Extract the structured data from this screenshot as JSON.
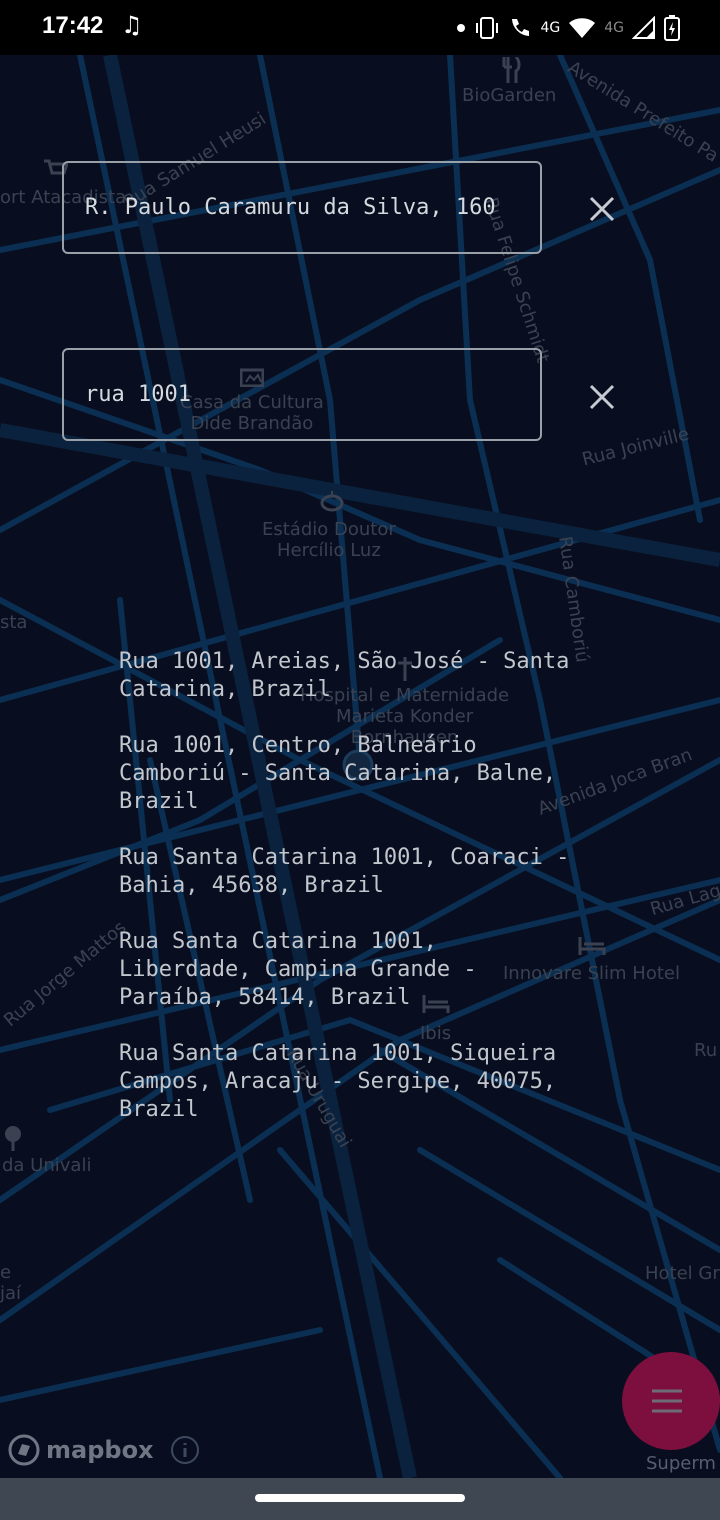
{
  "status_bar": {
    "time": "17:42",
    "network_labels": [
      "4G",
      "4G"
    ]
  },
  "map": {
    "labels": [
      {
        "id": "biogarden",
        "text": "BioGarden"
      },
      {
        "id": "atacadista",
        "text": "ort Atacadista"
      },
      {
        "id": "rua-samuel-heusi",
        "text": "Rua Samuel Heusi"
      },
      {
        "id": "av-prefeito",
        "text": "Avenida Prefeito Pa"
      },
      {
        "id": "rua-felipe-schmidt",
        "text": "Rua Felipe Schmidt"
      },
      {
        "id": "casa-cultura",
        "text": "Casa da Cultura\nDide Brandão"
      },
      {
        "id": "rua-joinville",
        "text": "Rua Joinville"
      },
      {
        "id": "estadio",
        "text": "Estádio Doutor\nHercílio Luz"
      },
      {
        "id": "rua-camboriu",
        "text": "Rua Camboriú"
      },
      {
        "id": "sta",
        "text": "sta"
      },
      {
        "id": "hospital",
        "text": "Hospital e Maternidade\nMarieta Konder\nBornhausen"
      },
      {
        "id": "av-joca",
        "text": "Avenida Joca Bran"
      },
      {
        "id": "rua-la",
        "text": "Rua Lag"
      },
      {
        "id": "innovare",
        "text": "Innovare Slim Hotel"
      },
      {
        "id": "rua-jorge-mattos",
        "text": "Rua Jorge Mattos"
      },
      {
        "id": "ibis",
        "text": "Ibis"
      },
      {
        "id": "rua-uruguai",
        "text": "Rua Uruguai"
      },
      {
        "id": "ru",
        "text": "Ru"
      },
      {
        "id": "univali",
        "text": "da Univali"
      },
      {
        "id": "e-jai",
        "text": "e\njaí"
      },
      {
        "id": "hotel-gr",
        "text": "Hotel Gr"
      },
      {
        "id": "superm",
        "text": "Superm"
      }
    ],
    "attribution": "mapbox"
  },
  "origin_field": {
    "value": "R. Paulo Caramuru da Silva, 160"
  },
  "destination_field": {
    "value": "rua 1001"
  },
  "results": [
    "Rua 1001, Areias, São José - Santa\nCatarina, Brazil",
    "Rua 1001, Centro, Balneário\nCamboriú - Santa Catarina, Balne,\nBrazil",
    "Rua Santa Catarina 1001, Coaraci -\nBahia, 45638, Brazil",
    "Rua Santa Catarina 1001,\nLiberdade, Campina Grande -\nParaíba, 58414, Brazil",
    "Rua Santa Catarina 1001, Siqueira\nCampos, Aracaju - Sergipe, 40075,\nBrazil"
  ],
  "colors": {
    "road": "#0e4778",
    "road_major": "#0f3a63",
    "fab": "#7d0f3e",
    "background": "#0a1326"
  },
  "icons": {
    "clear": "close-icon",
    "menu": "hamburger-icon",
    "info": "info-icon"
  }
}
